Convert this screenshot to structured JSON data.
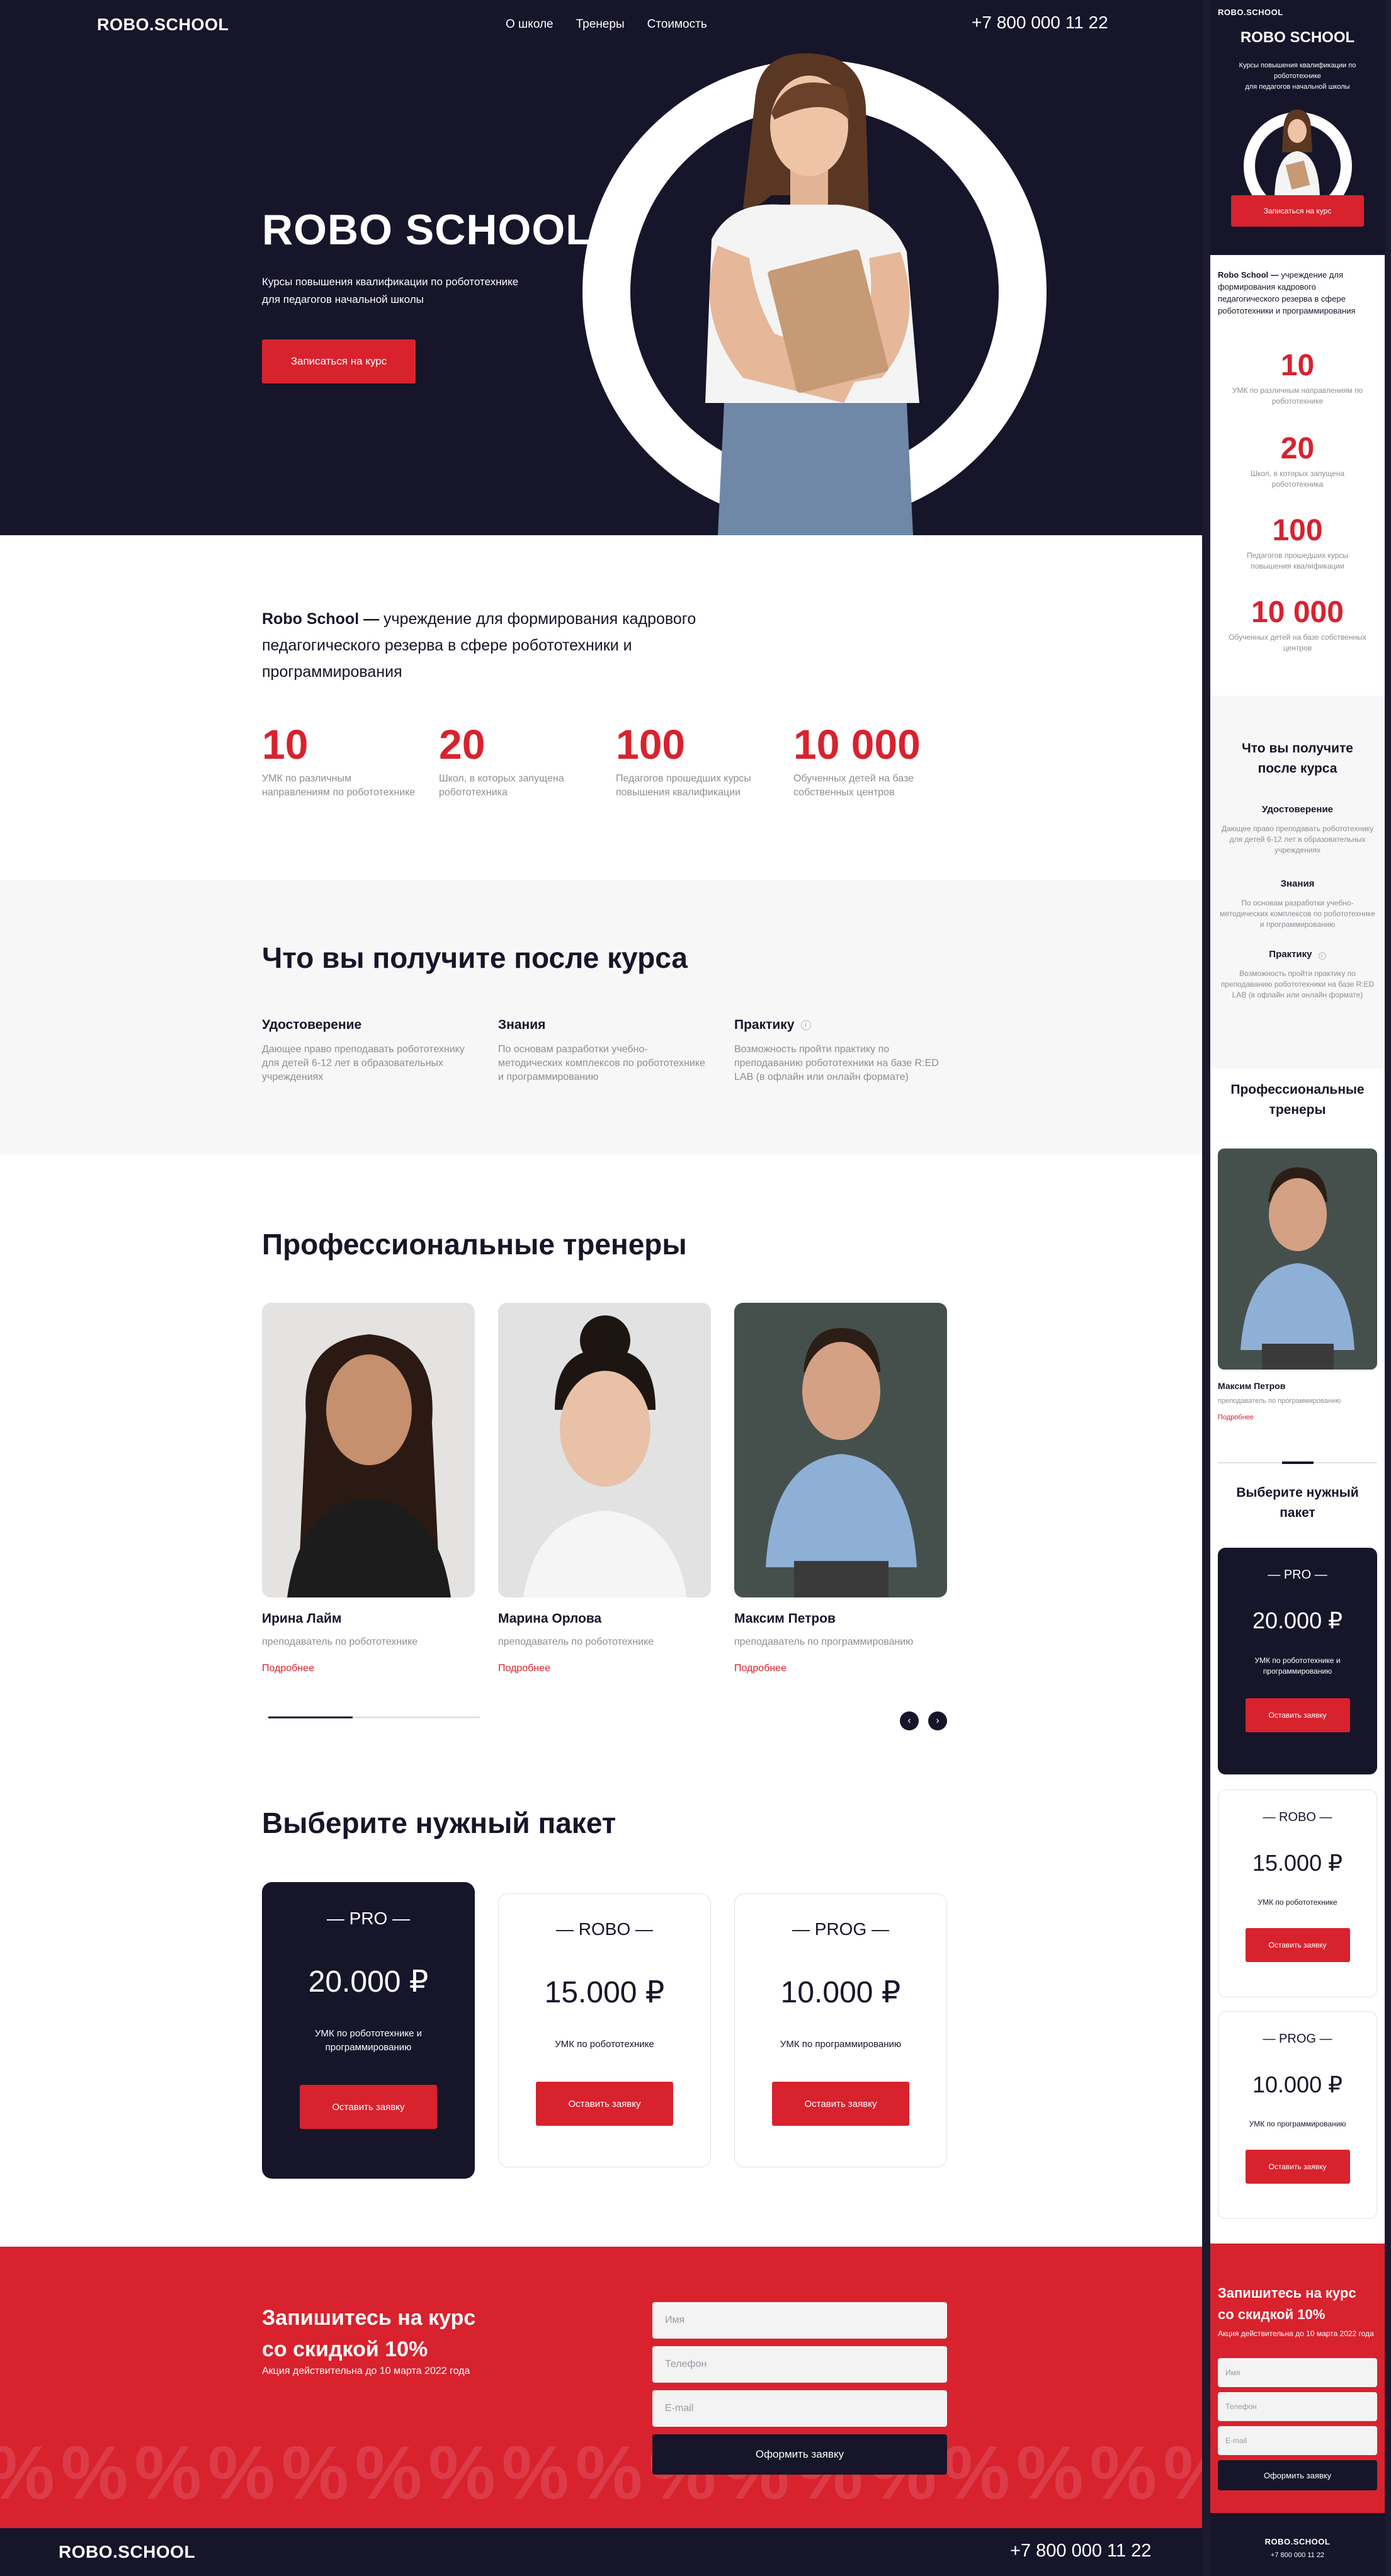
{
  "brand": {
    "logo": "ROBO.SCHOOL",
    "phone": "+7 800 000 11 22",
    "accent": "#d8222e",
    "dark": "#16152a"
  },
  "nav": {
    "items": [
      "О школе",
      "Тренеры",
      "Стоимость"
    ]
  },
  "hero": {
    "title": "ROBO SCHOOL",
    "subtitle_line1": "Курсы повышения квалификации по робототехнике",
    "subtitle_line2": "для педагогов начальной школы",
    "cta": "Записаться на курс"
  },
  "about": {
    "brand_bold": "Robo School —",
    "text": " учреждение для формирования кадрового педагогического резерва в сфере робототехники и программирования"
  },
  "stats": [
    {
      "value": "10",
      "label": "УМК по различным направлениям по робототехнике"
    },
    {
      "value": "20",
      "label": "Школ, в которых запущена робототехника"
    },
    {
      "value": "100",
      "label": "Педагогов прошедших курсы повышения квалификации"
    },
    {
      "value": "10 000",
      "label": "Обученных детей на базе собственных центров"
    }
  ],
  "benefits": {
    "title": "Что вы получите после курса",
    "mobile_title": "Что вы получите после курса",
    "items": [
      {
        "title": "Удостоверение",
        "text": "Дающее право преподавать робототехнику для детей 6-12 лет в образовательных учреждениях"
      },
      {
        "title": "Знания",
        "text": "По основам разработки учебно-методических комплексов по робототехнике и программированию"
      },
      {
        "title": "Практику",
        "text": "Возможность пройти практику по преподаванию робототехники на базе R:ED LAB (в офлайн или онлайн формате)",
        "info_icon": "info-icon"
      }
    ]
  },
  "trainers": {
    "title": "Профессиональные тренеры",
    "more": "Подробнее",
    "items": [
      {
        "name": "Ирина Лайм",
        "role": "преподаватель по робототехнике"
      },
      {
        "name": "Марина Орлова",
        "role": "преподаватель по робототехнике"
      },
      {
        "name": "Максим Петров",
        "role": "преподаватель по программированию"
      }
    ],
    "slider_progress": 0.4,
    "prev_icon": "chevron-left-icon",
    "next_icon": "chevron-right-icon"
  },
  "pricing": {
    "title": "Выберите нужный пакет",
    "button": "Оставить заявку",
    "plans": [
      {
        "name": "— PRO —",
        "price": "20.000 ₽",
        "desc_line1": "УМК по робототехнике и",
        "desc_line2": "программированию",
        "featured": true
      },
      {
        "name": "— ROBO —",
        "price": "15.000 ₽",
        "desc_line1": "УМК по робототехнике",
        "desc_line2": "",
        "featured": false
      },
      {
        "name": "— PROG —",
        "price": "10.000 ₽",
        "desc_line1": "УМК по программированию",
        "desc_line2": "",
        "featured": false
      }
    ]
  },
  "signup": {
    "title_line1": "Запишитесь на курс",
    "title_line2": "со скидкой 10%",
    "note": "Акция действительна до 10 марта 2022 года",
    "fields": {
      "name": "Имя",
      "phone": "Телефон",
      "email": "E-mail"
    },
    "submit": "Оформить заявку",
    "pattern": "%"
  },
  "footer": {
    "logo": "ROBO.SCHOOL",
    "phone": "+7 800 000 11 22"
  }
}
